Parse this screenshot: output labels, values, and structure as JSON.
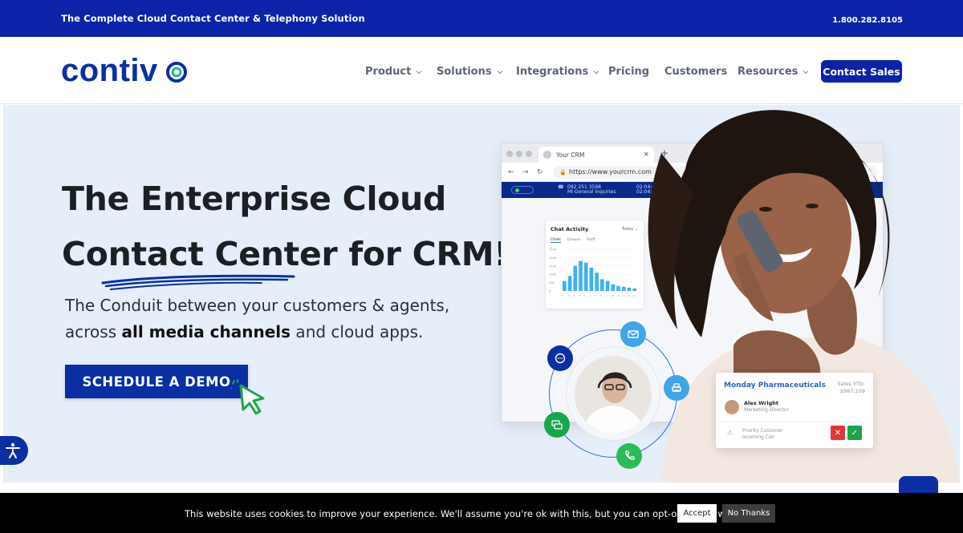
{
  "topbar": {
    "tagline": "The Complete Cloud Contact Center & Telephony Solution",
    "phone": "1.800.282.8105"
  },
  "brand": {
    "logo_text": "contiv",
    "logo_color": "#0a2fa3",
    "accent_green": "#2dbb8a"
  },
  "nav": {
    "items": [
      {
        "label": "Product",
        "dropdown": true
      },
      {
        "label": "Solutions",
        "dropdown": true
      },
      {
        "label": "Integrations",
        "dropdown": true
      },
      {
        "label": "Pricing",
        "dropdown": false
      },
      {
        "label": "Customers",
        "dropdown": false
      },
      {
        "label": "Resources",
        "dropdown": true
      }
    ],
    "cta_label": "Contact Sales"
  },
  "hero": {
    "headline_line1": "The Enterprise Cloud",
    "headline_line2": "Contact Center for CRM!",
    "sub_line1": "The Conduit between your customers & agents,",
    "sub_line2_pre": "across ",
    "sub_line2_bold": "all media channels",
    "sub_line2_post": " and cloud apps.",
    "cta_label": "SCHEDULE A DEMO"
  },
  "browser_mock": {
    "tab_title": "Your CRM",
    "url": "https://www.yourcrm.com",
    "crm_number": "082 251 3598",
    "crm_line": "MI General Inquiries",
    "timer1": "02:04:01",
    "timer2": "02:04:01",
    "chart": {
      "title": "Chat Activity",
      "range": "Today",
      "tabs": [
        "Chats",
        "Queues",
        "Staff"
      ],
      "y_ticks": [
        "250K",
        "200K",
        "150K",
        "100K",
        "50K",
        "0"
      ]
    }
  },
  "chart_data": {
    "type": "bar",
    "title": "Chat Activity",
    "categories": [
      "1",
      "2",
      "3",
      "4",
      "5",
      "6",
      "7",
      "8",
      "9",
      "10",
      "11",
      "12",
      "13",
      "14"
    ],
    "values": [
      60,
      90,
      150,
      180,
      170,
      140,
      110,
      70,
      60,
      40,
      30,
      25,
      20,
      15
    ],
    "ylim": [
      0,
      250
    ]
  },
  "contact_card": {
    "company": "Monday Pharmaceuticals",
    "sales_label": "Sales YTD:",
    "sales_value": "$967,109",
    "contact_name": "Alex Wright",
    "contact_role": "Marketing Director",
    "status_line1": "Priority Customer",
    "status_line2": "Incoming Call"
  },
  "cookie": {
    "message": "This website uses cookies to improve your experience. We'll assume you're ok with this, but you can opt-out if you wish.",
    "accept_label": "Accept",
    "decline_label": "No Thanks"
  }
}
